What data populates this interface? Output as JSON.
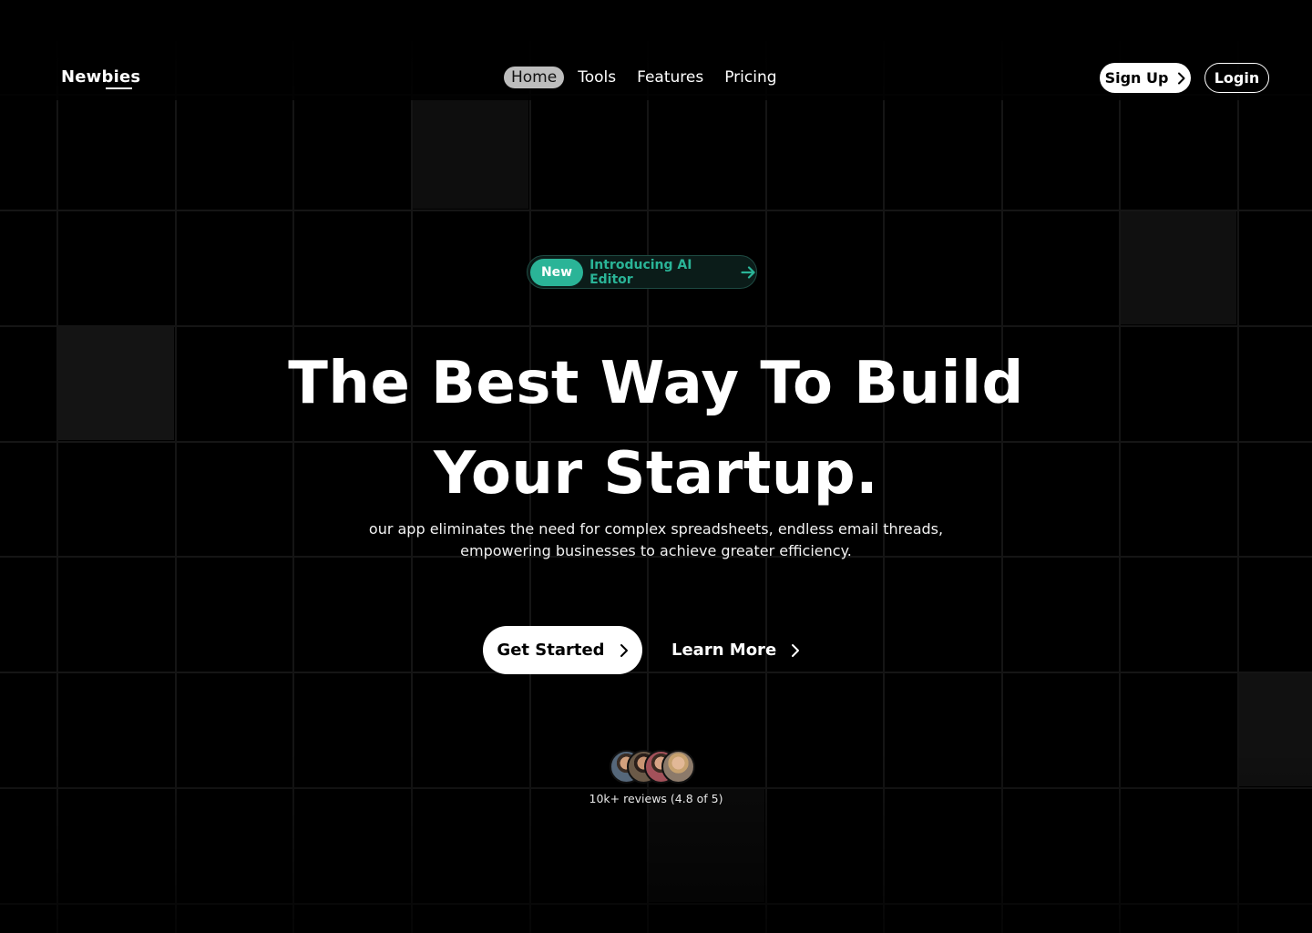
{
  "brand": {
    "name": "Newbies"
  },
  "nav": {
    "links": [
      {
        "label": "Home",
        "active": true
      },
      {
        "label": "Tools",
        "active": false
      },
      {
        "label": "Features",
        "active": false
      },
      {
        "label": "Pricing",
        "active": false
      }
    ],
    "signup_label": "Sign Up",
    "login_label": "Login"
  },
  "badge": {
    "tag": "New",
    "text": "Introducing AI Editor",
    "accent_color": "#2ab497"
  },
  "hero": {
    "title_line1": "The Best Way To Build",
    "title_line2": "Your Startup.",
    "subtitle_line1": "our app eliminates the need for complex spreadsheets, endless email threads,",
    "subtitle_line2": "empowering businesses to achieve greater efficiency.",
    "primary_cta": "Get Started",
    "secondary_cta": "Learn More"
  },
  "reviews": {
    "text": "10k+ reviews (4.8 of 5)",
    "avatar_count": 4
  },
  "icons": {
    "signup": "chevron-right-icon",
    "badge": "arrow-right-icon",
    "primary_cta": "chevron-right-icon",
    "secondary_cta": "chevron-right-icon"
  },
  "colors": {
    "background": "#000000",
    "accent": "#2ab497",
    "nav_active_bg": "#bdbdbd"
  }
}
